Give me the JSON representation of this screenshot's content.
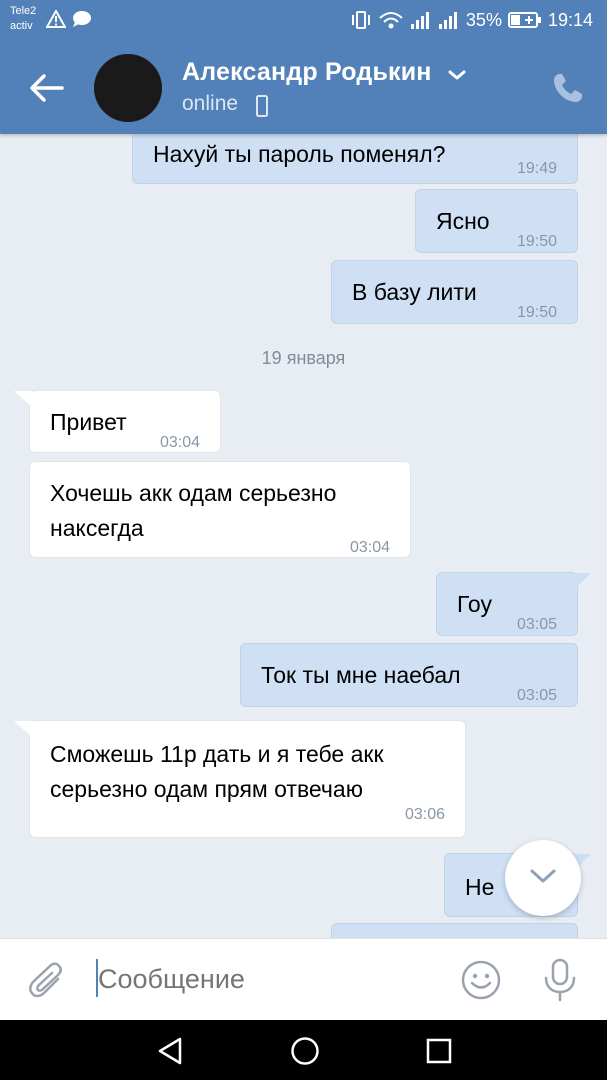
{
  "status_bar": {
    "carrier_line1": "Tele2",
    "carrier_line2": "activ",
    "battery": "35%",
    "time": "19:14"
  },
  "header": {
    "contact_name": "Александр Родькин",
    "status": "online"
  },
  "date_separator": "19 января",
  "messages": [
    {
      "direction": "out",
      "text": "Нахуй ты пароль поменял?",
      "time": "19:49"
    },
    {
      "direction": "out",
      "text": "Ясно",
      "time": "19:50"
    },
    {
      "direction": "out",
      "text": "В базу лити",
      "time": "19:50"
    },
    {
      "direction": "in",
      "text": "Привет",
      "time": "03:04"
    },
    {
      "direction": "in",
      "text_line1": "Хочешь акк одам серьезно",
      "text_line2": "наксегда",
      "time": "03:04"
    },
    {
      "direction": "out",
      "text": "Гоу",
      "time": "03:05"
    },
    {
      "direction": "out",
      "text": "Ток ты мне наебал",
      "time": "03:05"
    },
    {
      "direction": "in",
      "text_line1": "Сможешь 11р дать и я тебе акк",
      "text_line2": "серьезно одам прям отвечаю",
      "time": "03:06"
    },
    {
      "direction": "out",
      "text": "Не",
      "time": ""
    }
  ],
  "composer": {
    "placeholder": "Сообщение"
  },
  "colors": {
    "header_bg": "#5181b8",
    "chat_bg": "#e8edf3",
    "outgoing_bubble": "#cfe0f5",
    "incoming_bubble": "#ffffff"
  },
  "icons": [
    "back-arrow-icon",
    "chevron-down-icon",
    "phone-icon",
    "call-icon",
    "scroll-down-icon",
    "attach-icon",
    "emoji-icon",
    "mic-icon",
    "nav-back-icon",
    "nav-home-icon",
    "nav-recent-icon"
  ]
}
